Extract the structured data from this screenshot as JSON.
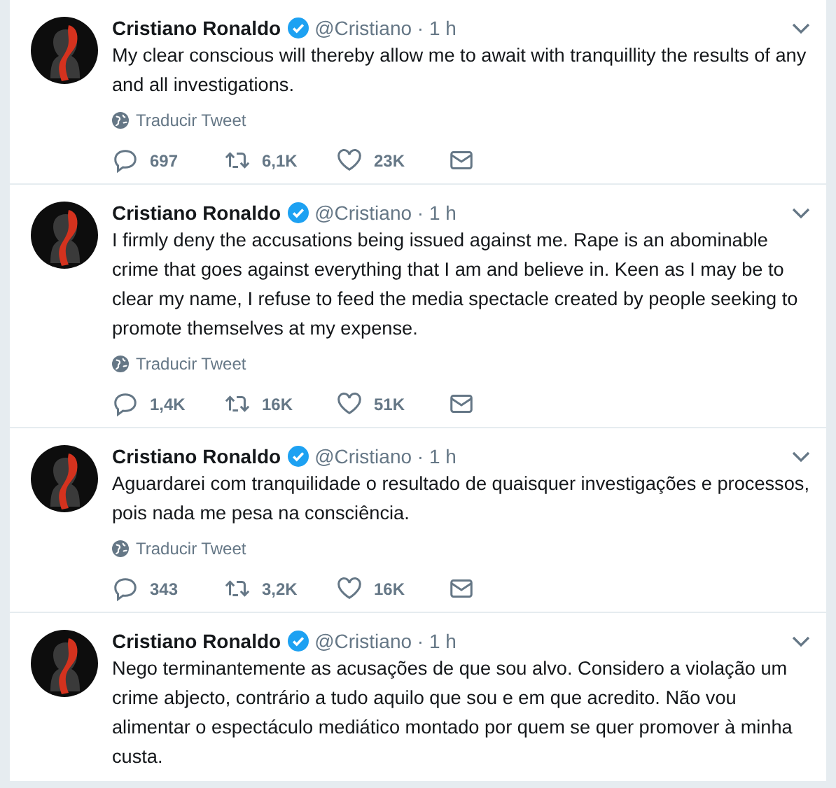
{
  "tweets": [
    {
      "name": "Cristiano Ronaldo",
      "verified": true,
      "meta": "@Cristiano · 1 h",
      "text": "My clear conscious will thereby allow me to await with tranquillity the results of any and all investigations.",
      "translate": "Traducir Tweet",
      "actions": [
        {
          "kind": "reply",
          "count": "697"
        },
        {
          "kind": "retweet",
          "count": "6,1K"
        },
        {
          "kind": "like",
          "count": "23K"
        },
        {
          "kind": "message"
        }
      ]
    },
    {
      "name": "Cristiano Ronaldo",
      "verified": true,
      "meta": "@Cristiano · 1 h",
      "text": "I firmly deny the accusations being issued against me. Rape is an abominable crime that goes against everything that I am and believe in. Keen as I may be to clear my name, I refuse to feed the media spectacle created by people seeking to promote themselves at my expense.",
      "translate": "Traducir Tweet",
      "actions": [
        {
          "kind": "reply",
          "count": "1,4K"
        },
        {
          "kind": "retweet",
          "count": "16K"
        },
        {
          "kind": "like",
          "count": "51K"
        },
        {
          "kind": "message"
        }
      ]
    },
    {
      "name": "Cristiano Ronaldo",
      "verified": true,
      "meta": "@Cristiano · 1 h",
      "text": "Aguardarei com tranquilidade o resultado de quaisquer investigações e processos, pois nada me pesa na consciência.",
      "translate": "Traducir Tweet",
      "actions": [
        {
          "kind": "reply",
          "count": "343"
        },
        {
          "kind": "retweet",
          "count": "3,2K"
        },
        {
          "kind": "like",
          "count": "16K"
        },
        {
          "kind": "message"
        }
      ]
    },
    {
      "name": "Cristiano Ronaldo",
      "verified": true,
      "meta": "@Cristiano · 1 h",
      "text": "Nego terminantemente as acusações de que sou alvo. Considero a violação um crime abjecto, contrário a tudo aquilo que sou e em que acredito. Não vou alimentar o espectáculo mediático montado por quem se quer promover à minha custa."
    }
  ]
}
